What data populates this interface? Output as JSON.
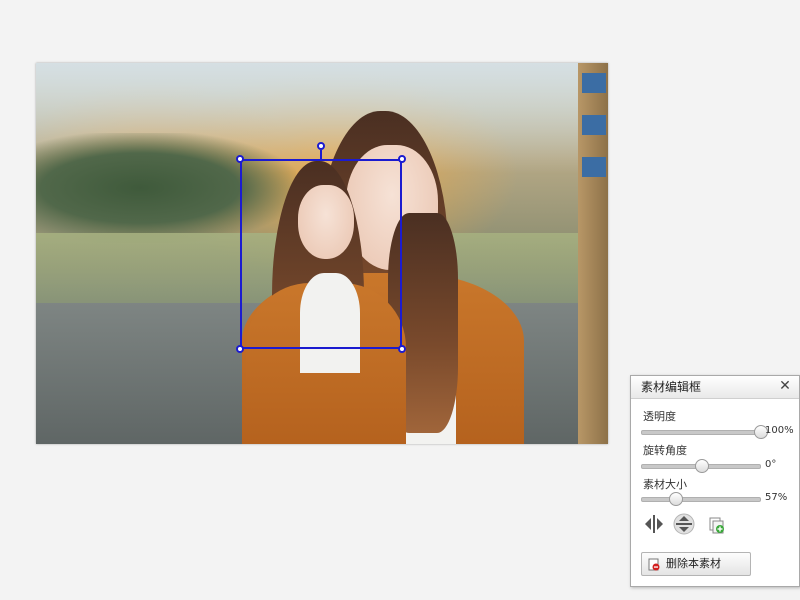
{
  "canvas": {
    "image_description_hidden": ""
  },
  "panel": {
    "title": "素材编辑框",
    "close_glyph": "✕",
    "rows": [
      {
        "label": "透明度",
        "value": "100%",
        "fraction": 1.0
      },
      {
        "label": "旋转角度",
        "value": "0°",
        "fraction": 0.5
      },
      {
        "label": "素材大小",
        "value": "57%",
        "fraction": 0.28
      }
    ],
    "tools": [
      "flip-horizontal-icon",
      "flip-vertical-icon",
      "copy-layer-icon"
    ],
    "delete_label": "删除本素材"
  },
  "colors": {
    "selection": "#1b1bd0",
    "accent_delete": "#d22020"
  }
}
